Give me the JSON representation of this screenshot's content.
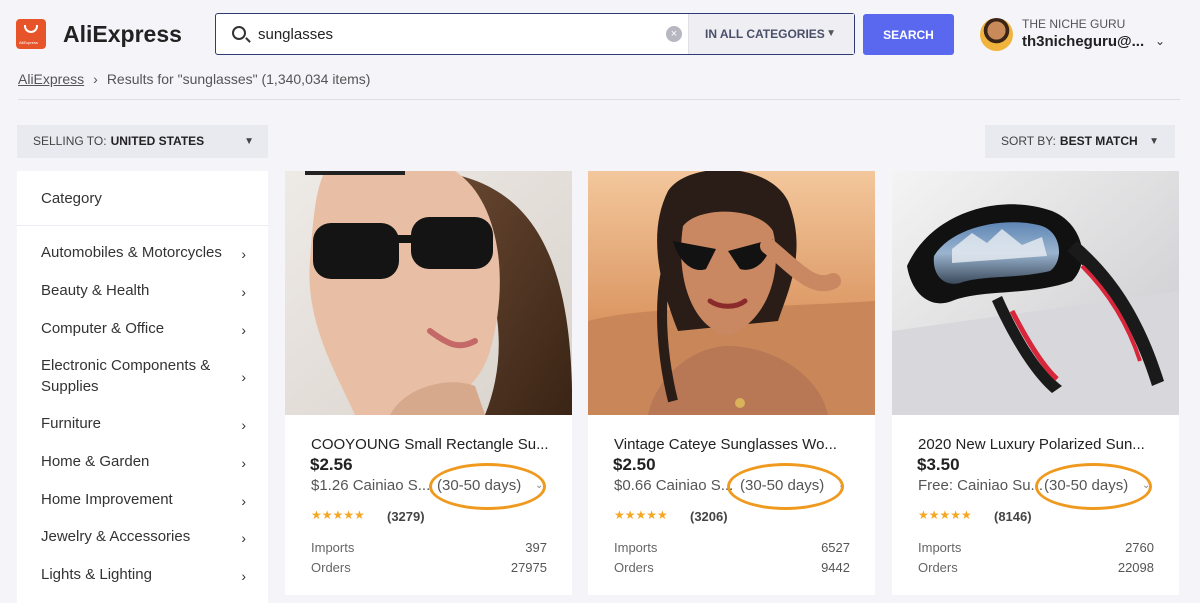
{
  "header": {
    "brand": "AliExpress",
    "logo_text": "AliExpress",
    "search": {
      "value": "sunglasses",
      "category": "IN ALL CATEGORIES",
      "button": "SEARCH"
    },
    "user": {
      "name": "THE NICHE GURU",
      "email": "th3nicheguru@..."
    }
  },
  "breadcrumb": {
    "home": "AliExpress",
    "sep": "›",
    "results": "Results for \"sunglasses\" (1,340,034 items)"
  },
  "filters": {
    "selling_label": "SELLING TO:",
    "selling_value": "UNITED STATES",
    "sort_label": "SORT BY:",
    "sort_value": "BEST MATCH"
  },
  "sidebar": {
    "heading": "Category",
    "items": [
      {
        "label": "Automobiles & Motorcycles"
      },
      {
        "label": "Beauty & Health"
      },
      {
        "label": "Computer & Office"
      },
      {
        "label": "Electronic Components & Supplies"
      },
      {
        "label": "Furniture"
      },
      {
        "label": "Home & Garden"
      },
      {
        "label": "Home Improvement"
      },
      {
        "label": "Jewelry & Accessories"
      },
      {
        "label": "Lights & Lighting"
      }
    ]
  },
  "products": [
    {
      "title": "COOYOUNG Small Rectangle Su...",
      "price": "$2.56",
      "shipping": "$1.26 Cainiao S...",
      "days": "(30-50 days)",
      "rating": 5,
      "reviews": "(3279)",
      "imports_label": "Imports",
      "imports": "397",
      "orders_label": "Orders",
      "orders": "27975"
    },
    {
      "title": "Vintage Cateye Sunglasses Wo...",
      "price": "$2.50",
      "shipping": "$0.66 Cainiao S...",
      "days": "(30-50 days)",
      "rating": 5,
      "reviews": "(3206)",
      "imports_label": "Imports",
      "imports": "6527",
      "orders_label": "Orders",
      "orders": "9442"
    },
    {
      "title": "2020 New Luxury Polarized Sun...",
      "price": "$3.50",
      "shipping": "Free: Cainiao Su...",
      "days": "(30-50 days)",
      "rating": 5,
      "reviews": "(8146)",
      "imports_label": "Imports",
      "imports": "2760",
      "orders_label": "Orders",
      "orders": "22098"
    }
  ],
  "colors": {
    "accent": "#5a68ef",
    "highlight_ring": "#ef9a1e",
    "star": "#f5a623",
    "brand": "#e8542a"
  },
  "icons": {
    "search": "magnifier-icon",
    "clear": "clear-icon",
    "dropdown": "chevron-down-icon",
    "item_arrow": "chevron-right-icon"
  }
}
